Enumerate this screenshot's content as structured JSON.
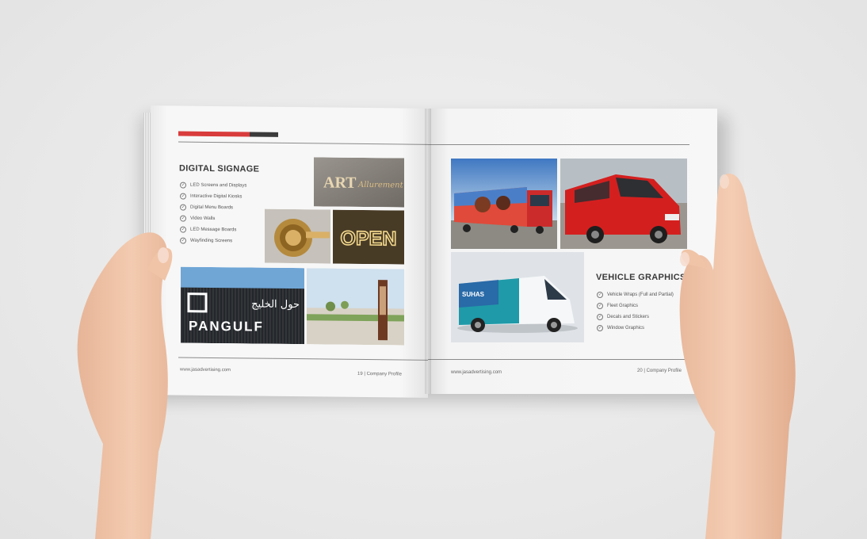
{
  "left_page": {
    "title": "DIGITAL SIGNAGE",
    "items": [
      "LED Screens and Displays",
      "Interactive Digital Kiosks",
      "Digital Menu Boards",
      "Video Walls",
      "LED Message Boards",
      "Wayfinding Screens"
    ],
    "footer_url": "www.jasadvertising.com",
    "footer_page": "19 | Company Profile",
    "photos": {
      "art_sign_text": "ART",
      "art_script_text": "Allurement",
      "open_sign_text": "OPEN",
      "pangulf_arabic": "حول الخليج",
      "pangulf_latin": "PANGULF"
    }
  },
  "right_page": {
    "title": "VEHICLE GRAPHICS",
    "items": [
      "Vehicle Wraps (Full and Partial)",
      "Fleet Graphics",
      "Decals and Stickers",
      "Window Graphics"
    ],
    "footer_url": "www.jasadvertising.com",
    "footer_page": "20 | Company Profile",
    "photos": {
      "van_brand": "SUHAS"
    }
  },
  "colors": {
    "accent_red": "#d93c3c",
    "accent_dark": "#3b3b3b",
    "background": "#ebebeb",
    "skin": "#f2c9ae"
  }
}
